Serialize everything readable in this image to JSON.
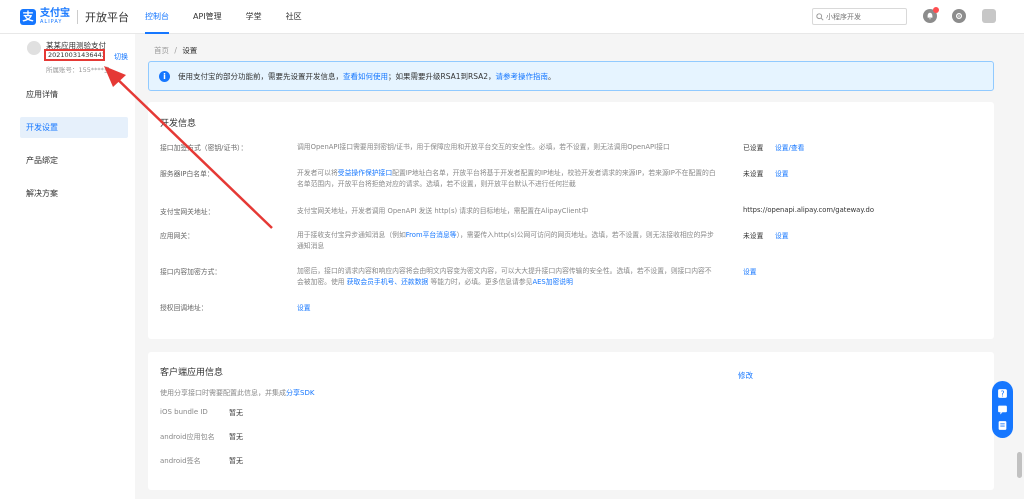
{
  "header": {
    "logo_cn": "支付宝",
    "logo_en": "ALIPAY",
    "platform_title": "开放平台",
    "nav": [
      "控制台",
      "API管理",
      "学堂",
      "社区"
    ],
    "search_placeholder": "小程序开发"
  },
  "sidebar": {
    "app_name": "某某应用测验支付",
    "app_id": "2021003143644398",
    "switch_label": "切换",
    "account": "所属账号：155****多",
    "menu": [
      "应用详情",
      "开发设置",
      "产品绑定",
      "解决方案"
    ],
    "active_menu": "开发设置"
  },
  "breadcrumb": {
    "home": "首页",
    "sep": "/",
    "current": "设置"
  },
  "notice": {
    "text1": "使用支付宝的部分功能前，需要先设置开发信息，",
    "link1": "查看如何使用",
    "text2": "；如果需要升级RSA1到RSA2，",
    "link2": "请参考操作指南",
    "text3": "。"
  },
  "dev_info": {
    "title": "开发信息",
    "rows": [
      {
        "label": "接口加签方式（密钥/证书）：",
        "desc": "调用OpenAPI接口需要用到密钥/证书，用于保障应用和开放平台交互的安全性。必填，若不设置，则无法调用OpenAPI接口",
        "status": "已设置",
        "action": "设置/查看"
      },
      {
        "label": "服务器IP白名单：",
        "desc_pre": "开发者可以将",
        "desc_link": "受益操作保护接口",
        "desc_post": "配置IP地址白名单，开放平台将基于开发者配置的IP地址，校验开发者请求的来源IP，若来源IP不在配置的白名单范围内，开放平台将拒绝对应的请求。选填，若不设置，则开放平台默认不进行任何拦截",
        "status": "未设置",
        "action": "设置"
      },
      {
        "label": "支付宝网关地址：",
        "desc": "支付宝网关地址，开发者调用 OpenAPI 发送 http(s) 请求的目标地址，需配置在AlipayClient中",
        "value": "https://openapi.alipay.com/gateway.do"
      },
      {
        "label": "应用网关：",
        "desc_pre": "用于接收支付宝异步通知消息（例如",
        "desc_link": "From平台消息等",
        "desc_post": "），需要传入http(s)公网可访问的网页地址。选填，若不设置，则无法接收相应的异步通知消息",
        "status": "未设置",
        "action": "设置"
      },
      {
        "label": "接口内容加密方式：",
        "desc_pre": "加密后，接口的请求内容和响应内容将会由明文内容变为密文内容，可以大大提升接口内容传输的安全性。选填，若不设置，则接口内容不会被加密。使用 ",
        "desc_link": "获取会员手机号、还款数据",
        "desc_mid": " 等能力时，必填。更多信息请参见",
        "desc_link2": "AES加密说明",
        "action": "设置"
      },
      {
        "label": "授权回调地址：",
        "action": "设置"
      }
    ]
  },
  "client_info": {
    "title": "客户端应用信息",
    "desc_pre": "使用分享接口时需要配置此信息，并集成",
    "desc_link": "分享SDK",
    "edit": "修改",
    "rows": [
      {
        "key": "iOS bundle ID",
        "value": "暂无"
      },
      {
        "key": "android应用包名",
        "value": "暂无"
      },
      {
        "key": "android签名",
        "value": "暂无"
      }
    ]
  },
  "colors": {
    "brand": "#1677ff",
    "annotation": "#e53935"
  }
}
